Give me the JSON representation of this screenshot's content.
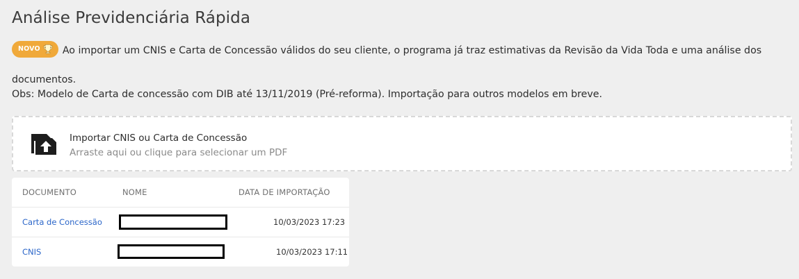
{
  "page": {
    "title": "Análise Previdenciária Rápida",
    "badge_label": "NOVO",
    "intro_text": "Ao importar um CNIS e Carta de Concessão válidos do seu cliente, o programa já traz estimativas da Revisão da Vida Toda e uma análise dos documentos.",
    "obs_text": "Obs: Modelo de Carta de concessão com DIB até 13/11/2019 (Pré-reforma). Importação para outros modelos em breve."
  },
  "dropzone": {
    "title": "Importar CNIS ou Carta de Concessão",
    "subtitle": "Arraste aqui ou clique para selecionar um PDF",
    "icon": "upload-file-icon"
  },
  "table": {
    "headers": {
      "documento": "DOCUMENTO",
      "nome": "NOME",
      "data": "DATA DE IMPORTAÇÃO"
    },
    "rows": [
      {
        "documento": "Carta de Concessão",
        "nome": "",
        "data": "10/03/2023 17:23"
      },
      {
        "documento": "CNIS",
        "nome": "",
        "data": "10/03/2023 17:11"
      }
    ]
  },
  "colors": {
    "badge": "#f0a93a",
    "link": "#2b66c9",
    "background": "#efefef"
  }
}
